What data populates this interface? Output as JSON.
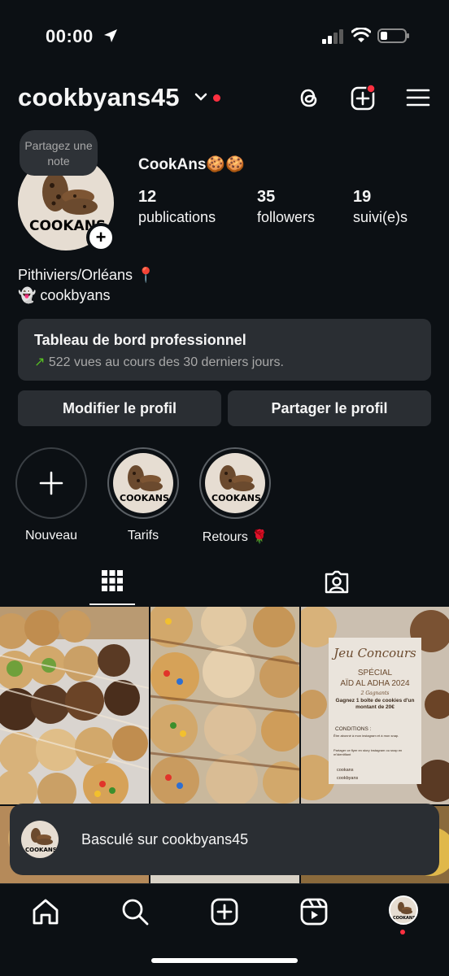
{
  "status_bar": {
    "time": "00:00"
  },
  "header": {
    "username": "cookbyans45"
  },
  "profile": {
    "note_text": "Partagez une note",
    "display_name": "CookAns🍪🍪",
    "avatar_logo_text": "COOKANS",
    "stats": [
      {
        "value": "12",
        "label": "publications"
      },
      {
        "value": "35",
        "label": "followers"
      },
      {
        "value": "19",
        "label": "suivi(e)s"
      }
    ],
    "bio_line1": "Pithiviers/Orléans 📍",
    "bio_line2": "👻 cookbyans"
  },
  "dashboard": {
    "title": "Tableau de bord professionnel",
    "arrow": "↗",
    "subtitle": "522 vues au cours des 30 derniers jours."
  },
  "buttons": {
    "edit": "Modifier le profil",
    "share": "Partager le profil"
  },
  "highlights": [
    {
      "label": "Nouveau",
      "icon": "plus-icon"
    },
    {
      "label": "Tarifs",
      "logo": "COOKANS"
    },
    {
      "label": "Retours 🌹",
      "logo": "COOKANS"
    }
  ],
  "tabs": [
    {
      "icon": "grid-icon",
      "active": true
    },
    {
      "icon": "tagged-icon",
      "active": false
    }
  ],
  "posts": {
    "contest_title": "Jeu Concours",
    "contest_special": "SPÉCIAL",
    "contest_event": "AÏD AL ADHA 2024",
    "contest_winners": "2 Gagnants",
    "contest_prize": "Gagnez 1 boîte de cookies d'un montant de 20€",
    "contest_conditions_title": "CONDITIONS :",
    "contest_condition1": "Être abonné à mon instagram et à mon snap.",
    "contest_condition2": "Partager ce flyer en story instagram ou snap en m'identifiant",
    "contest_snap": "cookans",
    "contest_insta": "cookbyans"
  },
  "toast": {
    "text": "Basculé sur cookbyans45"
  },
  "colors": {
    "background": "#0c1014",
    "surface": "#2a2e33",
    "notification": "#ff3040",
    "trend": "#58c322"
  }
}
